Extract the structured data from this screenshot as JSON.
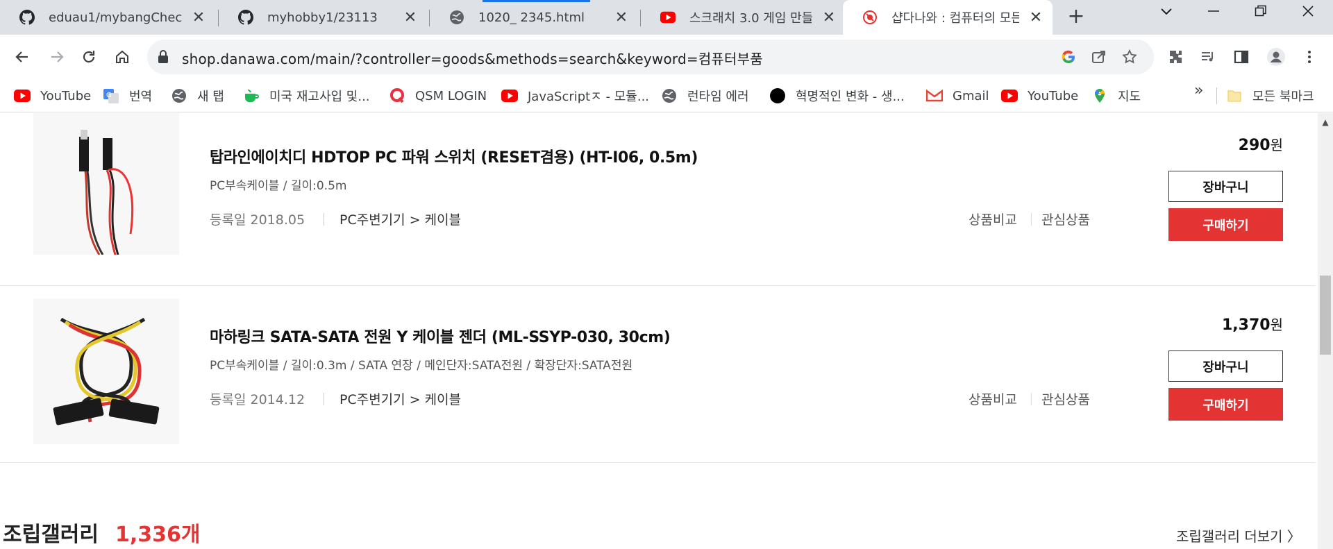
{
  "tabs": [
    {
      "title": "eduau1/mybangCheck",
      "icon": "github-icon",
      "close": "✕"
    },
    {
      "title": "myhobby1/23113",
      "icon": "github-icon",
      "close": "✕"
    },
    {
      "title": "1020_ 2345.html",
      "icon": "globe-icon",
      "close": "✕"
    },
    {
      "title": "스크래치 3.0 게임 만들기",
      "icon": "youtube-icon",
      "close": "✕"
    },
    {
      "title": "샵다나와 : 컴퓨터의 모든",
      "icon": "danawa-icon",
      "close": "✕",
      "active": true
    }
  ],
  "newtab_label": "+",
  "window_controls": {
    "minimize": "—",
    "restore": "❐",
    "close": "✕",
    "tablist": "⌄"
  },
  "address_bar": {
    "url": "shop.danawa.com/main/?controller=goods&methods=search&keyword=컴퓨터부품"
  },
  "bookmarks": [
    {
      "label": "YouTube",
      "icon": "youtube-icon"
    },
    {
      "label": "번역",
      "icon": "translate-icon"
    },
    {
      "label": "새 탭",
      "icon": "globe-icon"
    },
    {
      "label": "미국 재고사입 및...",
      "icon": "cup-icon"
    },
    {
      "label": "QSM LOGIN",
      "icon": "qsm-icon"
    },
    {
      "label": "JavaScriptㅈ - 모듈...",
      "icon": "youtube-icon"
    },
    {
      "label": "런타임 에러",
      "icon": "globe-icon"
    },
    {
      "label": "혁명적인 변화 - 생...",
      "icon": "black-circle-icon"
    },
    {
      "label": "Gmail",
      "icon": "gmail-icon"
    },
    {
      "label": "YouTube",
      "icon": "youtube-icon"
    },
    {
      "label": "지도",
      "icon": "maps-icon"
    }
  ],
  "bookmarks_more": "»",
  "all_bookmarks": "모든 북마크",
  "products": [
    {
      "name": "탑라인에이치디 HDTOP PC 파워 스위치 (RESET겸용) (HT-I06, 0.5m)",
      "spec": "PC부속케이블 / 길이:0.5m",
      "date": "등록일 2018.05",
      "category": "PC주변기기 > 케이블",
      "compare": "상품비교",
      "wish": "관심상품",
      "price": "290",
      "price_unit": "원",
      "cart": "장바구니",
      "buy": "구매하기"
    },
    {
      "name": "마하링크 SATA-SATA 전원 Y 케이블 젠더 (ML-SSYP-030, 30cm)",
      "spec": "PC부속케이블 / 길이:0.3m / SATA 연장 / 메인단자:SATA전원 / 확장단자:SATA전원",
      "date": "등록일 2014.12",
      "category": "PC주변기기 > 케이블",
      "compare": "상품비교",
      "wish": "관심상품",
      "price": "1,370",
      "price_unit": "원",
      "cart": "장바구니",
      "buy": "구매하기"
    }
  ],
  "gallery": {
    "title": "조립갤러리",
    "count": "1,336개",
    "more": "조립갤러리 더보기 〉"
  },
  "colors": {
    "accent_red": "#e43333",
    "chrome_tabstrip": "#dee1e6",
    "omnibox": "#f1f3f4"
  }
}
